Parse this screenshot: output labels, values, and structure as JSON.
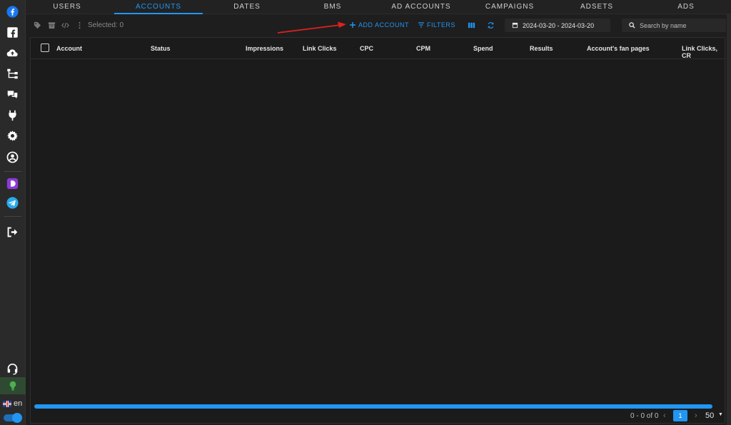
{
  "colors": {
    "accent": "#2196f3",
    "arrow": "#e02020",
    "sidebar_bg": "#2a2a2a"
  },
  "sidebar": {
    "items": [
      {
        "name": "facebook-icon"
      },
      {
        "name": "fanpage-icon"
      },
      {
        "name": "upload-icon"
      },
      {
        "name": "hierarchy-icon"
      },
      {
        "name": "chat-icon"
      },
      {
        "name": "plug-icon"
      },
      {
        "name": "gear-icon"
      },
      {
        "name": "user-circle-icon"
      },
      {
        "name": "dolphin-icon"
      },
      {
        "name": "telegram-icon"
      },
      {
        "name": "logout-icon"
      },
      {
        "name": "headset-icon"
      },
      {
        "name": "bulb-icon"
      }
    ],
    "language": "en"
  },
  "tabs": [
    "USERS",
    "ACCOUNTS",
    "DATES",
    "BMS",
    "AD ACCOUNTS",
    "CAMPAIGNS",
    "ADSETS",
    "ADS"
  ],
  "active_tab": "ACCOUNTS",
  "toolbar": {
    "selected": "Selected: 0",
    "add_account": "ADD ACCOUNT",
    "filters": "FILTERS",
    "date_range": "2024-03-20 - 2024-03-20",
    "search_placeholder": "Search by name"
  },
  "table": {
    "columns": [
      "Account",
      "Status",
      "Impressions",
      "Link Clicks",
      "CPC",
      "CPM",
      "Spend",
      "Results",
      "Account's fan pages",
      "Link Clicks, CR"
    ]
  },
  "pagination": {
    "range": "0 - 0 of 0",
    "current_page": "1",
    "per_page": "50"
  }
}
